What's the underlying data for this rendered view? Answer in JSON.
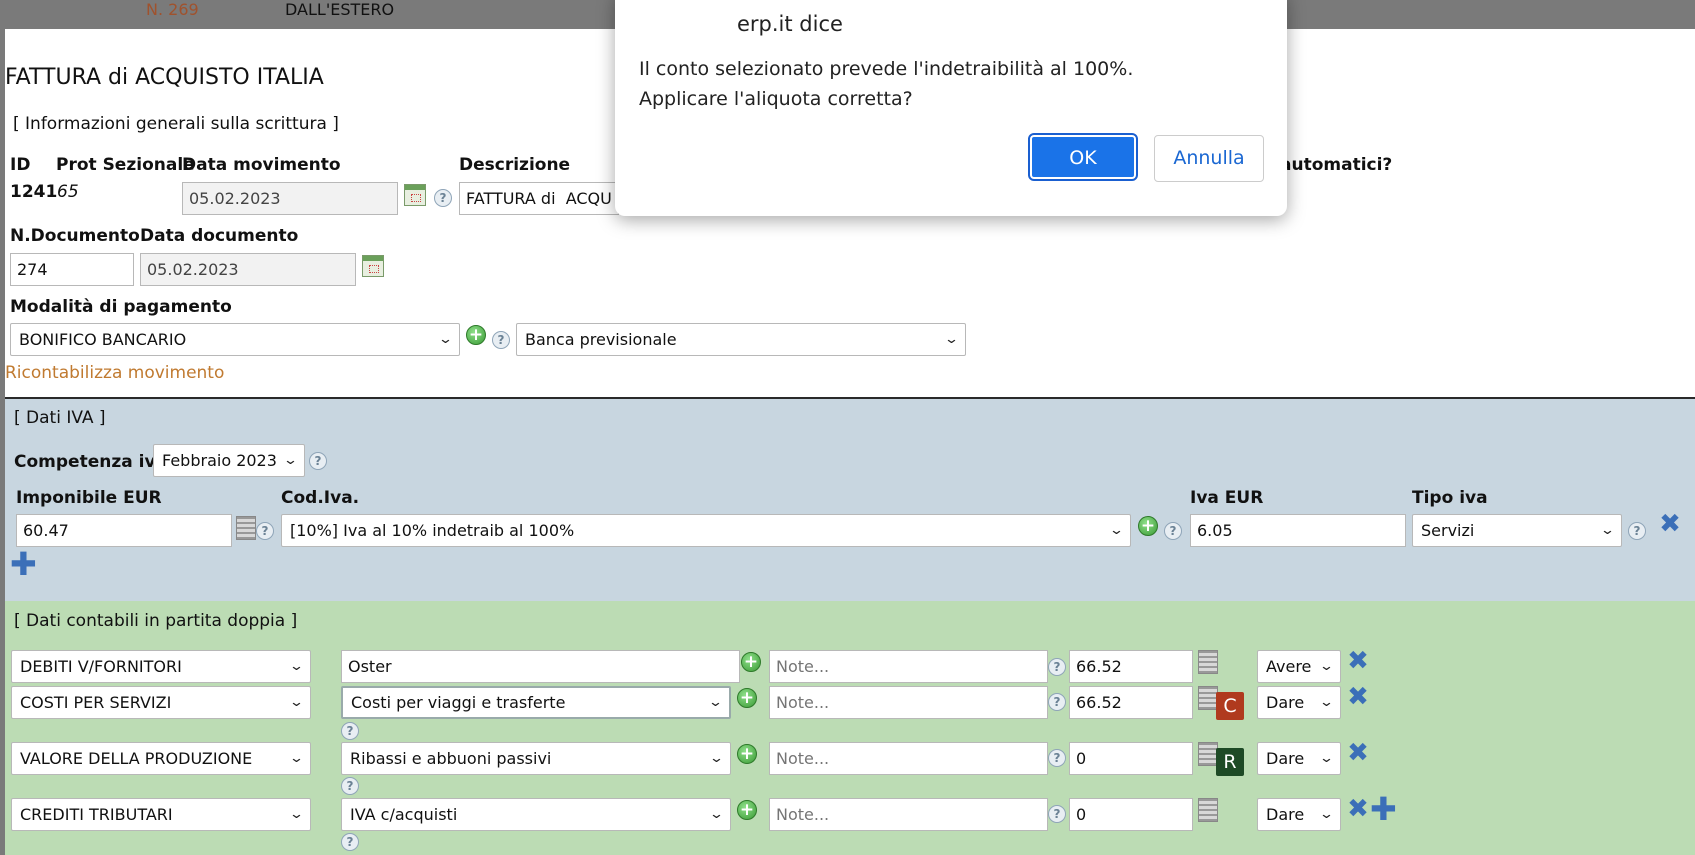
{
  "background_row": {
    "num_prefix": "N.",
    "num_value": "269",
    "desc": "DALL'ESTERO"
  },
  "form": {
    "title": "FATTURA di ACQUISTO ITALIA",
    "general_section": "[ Informazioni generali sulla scrittura ]",
    "id_label": "ID",
    "id_value": "1241",
    "prot_label": "Prot Sezionale",
    "prot_value": "65",
    "data_mov_label": "Data movimento",
    "data_mov_value": "05.02.2023",
    "descr_label": "Descrizione",
    "descr_value": "FATTURA di  ACQUISTO ITALIA",
    "auto_label": "automatici?",
    "ndoc_label": "N.Documento",
    "ndoc_value": "274",
    "data_doc_label": "Data documento",
    "data_doc_value": "05.02.2023",
    "pagamento_label": "Modalità di pagamento",
    "pagamento_value": "BONIFICO BANCARIO",
    "banca_value": "Banca previsionale",
    "ricontabilizza": "Ricontabilizza movimento"
  },
  "iva": {
    "section": "[ Dati IVA ]",
    "competenza_label": "Competenza iva:",
    "competenza_value": "Febbraio 2023",
    "imponibile_label": "Imponibile EUR",
    "imponibile_value": "60.47",
    "codiva_label": "Cod.Iva.",
    "codiva_value": "[10%] Iva al 10% indetraib al 100%",
    "ivaeur_label": "Iva EUR",
    "ivaeur_value": "6.05",
    "tipo_label": "Tipo iva",
    "tipo_value": "Servizi"
  },
  "contabili": {
    "section": "[ Dati contabili in partita doppia ]",
    "note_placeholder": "Note...",
    "rows": [
      {
        "conto": "DEBITI V/FORNITORI",
        "sottoconto": "Oster",
        "amount": "66.52",
        "dc": "Avere"
      },
      {
        "conto": "COSTI PER SERVIZI",
        "sottoconto": "Costi per viaggi e trasferte",
        "amount": "66.52",
        "dc": "Dare",
        "badge": "C"
      },
      {
        "conto": "VALORE DELLA PRODUZIONE",
        "sottoconto": "Ribassi e abbuoni passivi",
        "amount": "0",
        "dc": "Dare",
        "badge": "R"
      },
      {
        "conto": "CREDITI TRIBUTARI",
        "sottoconto": "IVA c/acquisti",
        "amount": "0",
        "dc": "Dare"
      }
    ]
  },
  "dialog": {
    "title": "erp.it dice",
    "line1": "Il conto selezionato prevede l'indetraibilità al 100%.",
    "line2": "Applicare l'aliquota corretta?",
    "ok": "OK",
    "cancel": "Annulla"
  },
  "colors": {
    "iva_bg": "#c8d6e0",
    "contabili_bg": "#bcdcb4",
    "ok_button": "#1a73e8",
    "link": "#c07a30"
  }
}
